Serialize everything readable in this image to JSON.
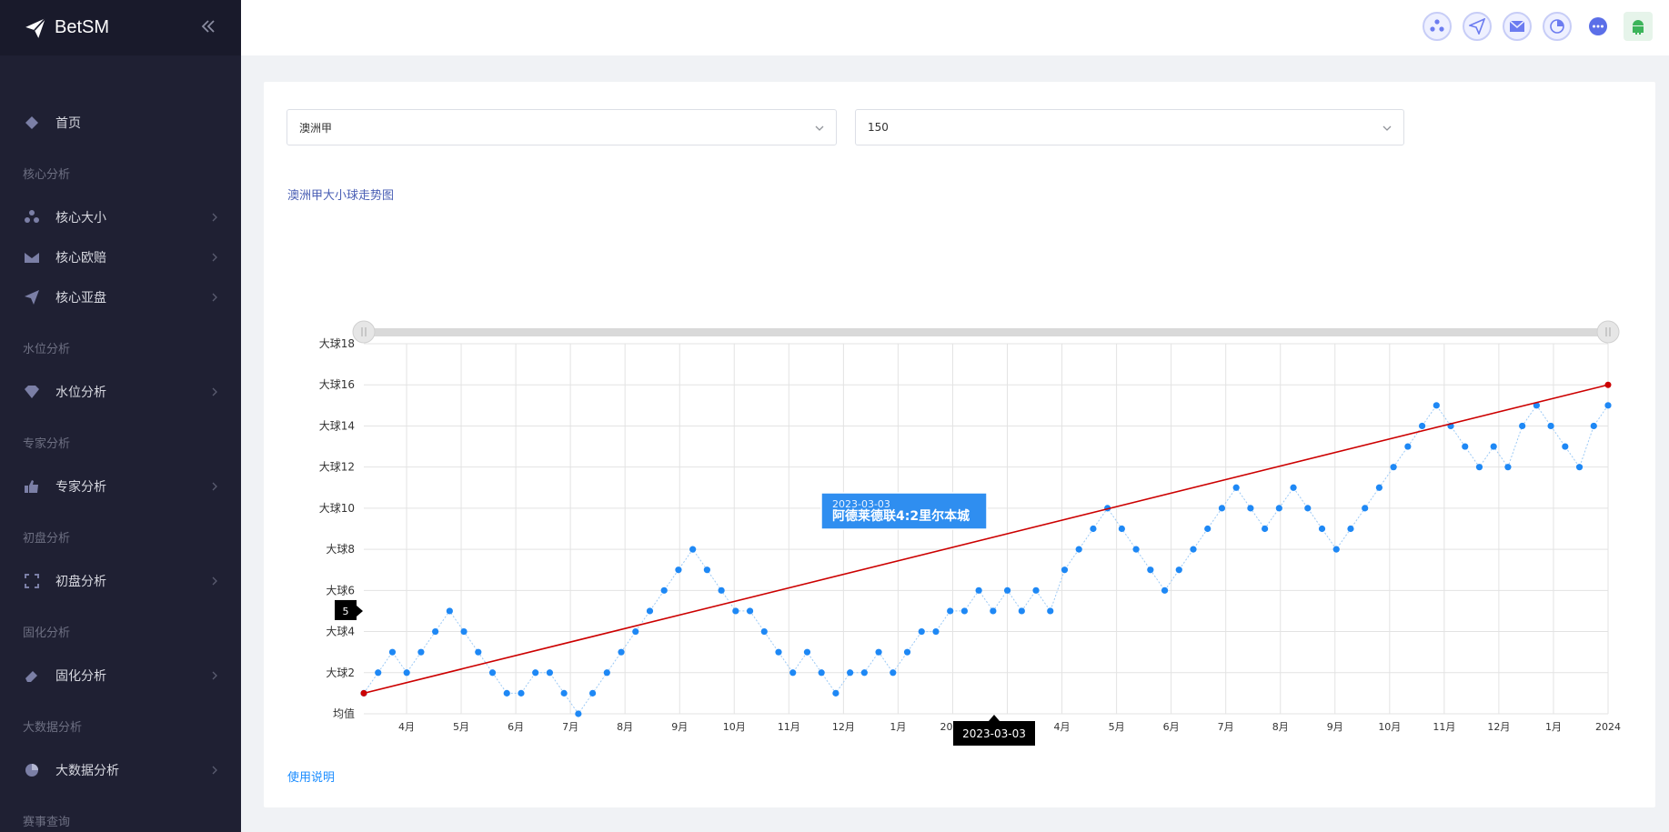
{
  "brand": {
    "name": "BetSM",
    "logo_icon": "paper-plane-icon",
    "collapse_icon": "double-chevron-left-icon"
  },
  "sidebar": {
    "home": {
      "label": "首页",
      "icon": "diamond-icon"
    },
    "groups": [
      {
        "title": "核心分析",
        "items": [
          {
            "label": "核心大小",
            "icon": "cluster-icon"
          },
          {
            "label": "核心欧赔",
            "icon": "envelope-icon"
          },
          {
            "label": "核心亚盘",
            "icon": "paper-plane-icon"
          }
        ]
      },
      {
        "title": "水位分析",
        "items": [
          {
            "label": "水位分析",
            "icon": "gem-icon"
          }
        ]
      },
      {
        "title": "专家分析",
        "items": [
          {
            "label": "专家分析",
            "icon": "thumbs-up-icon"
          }
        ]
      },
      {
        "title": "初盘分析",
        "items": [
          {
            "label": "初盘分析",
            "icon": "frame-corners-icon"
          }
        ]
      },
      {
        "title": "固化分析",
        "items": [
          {
            "label": "固化分析",
            "icon": "eraser-icon"
          }
        ]
      },
      {
        "title": "大数据分析",
        "items": [
          {
            "label": "大数据分析",
            "icon": "pie-chart-icon"
          }
        ]
      },
      {
        "title": "赛事查询",
        "items": []
      }
    ]
  },
  "header": {
    "icons": [
      "cluster-icon",
      "paper-plane-icon",
      "envelope-icon",
      "pie-chart-icon",
      "chat-bubble-icon",
      "android-icon"
    ]
  },
  "filters": {
    "league": "澳洲甲",
    "count": "150"
  },
  "chart": {
    "title": "澳洲甲大小球走势图",
    "usage_link": "使用说明"
  },
  "chart_data": {
    "type": "line",
    "y_ticks": [
      "均值",
      "大球2",
      "大球4",
      "大球6",
      "大球8",
      "大球10",
      "大球12",
      "大球14",
      "大球16",
      "大球18"
    ],
    "ylim": [
      0,
      18
    ],
    "x_ticks": [
      "4月",
      "5月",
      "6月",
      "7月",
      "8月",
      "9月",
      "10月",
      "11月",
      "12月",
      "1月",
      "2023",
      "3月",
      "4月",
      "5月",
      "6月",
      "7月",
      "8月",
      "9月",
      "10月",
      "11月",
      "12月",
      "1月",
      "2024"
    ],
    "series": [
      {
        "values": [
          1,
          2,
          3,
          2,
          3,
          4,
          5,
          4,
          3,
          2,
          1,
          1,
          2,
          2,
          1,
          0,
          1,
          2,
          3,
          4,
          5,
          6,
          7,
          8,
          7,
          6,
          5,
          5,
          4,
          3,
          2,
          3,
          2,
          1,
          2,
          2,
          3,
          2,
          3,
          4,
          4,
          5,
          5,
          6,
          5,
          6,
          5,
          6,
          5,
          7,
          8,
          9,
          10,
          9,
          8,
          7,
          6,
          7,
          8,
          9,
          10,
          11,
          10,
          9,
          10,
          11,
          10,
          9,
          8,
          9,
          10,
          11,
          12,
          13,
          14,
          15,
          14,
          13,
          12,
          13,
          12,
          14,
          15,
          14,
          13,
          12,
          14,
          15
        ]
      }
    ],
    "trend": {
      "start": 1,
      "end": 16
    },
    "tooltip": {
      "date": "2023-03-03",
      "match": "阿德莱德联4:2里尔本城"
    },
    "axis_pointer": {
      "x_label": "2023-03-03",
      "y_label": "5"
    },
    "colors": {
      "points": "#1e88f5",
      "trend": "#cc0000",
      "grid": "#e0e0e0"
    },
    "slider": "full-range"
  }
}
